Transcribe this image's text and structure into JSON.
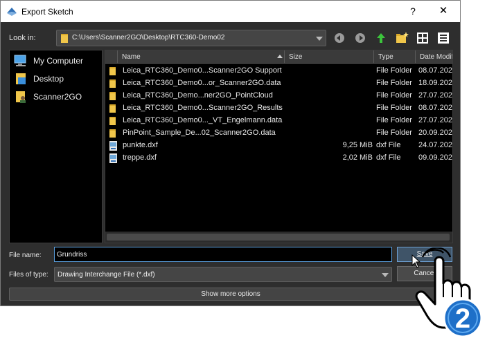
{
  "window": {
    "title": "Export Sketch",
    "help": "?",
    "close": "✕"
  },
  "lookin": {
    "label": "Look in:",
    "path": "C:\\Users\\Scanner2GO\\Desktop\\RTC360-Demo02"
  },
  "toolbar": [
    "back-icon",
    "forward-icon",
    "parent-folder-icon",
    "new-folder-icon",
    "detail-view-icon",
    "list-view-icon"
  ],
  "sidebar": {
    "items": [
      {
        "label": "My Computer",
        "icon": "computer-icon"
      },
      {
        "label": "Desktop",
        "icon": "desktop-icon"
      },
      {
        "label": "Scanner2GO",
        "icon": "user-folder-icon"
      }
    ]
  },
  "columns": {
    "name": "Name",
    "size": "Size",
    "type": "Type",
    "date": "Date Modifi"
  },
  "files": [
    {
      "name": "Leica_RTC360_Demo0...Scanner2GO Support",
      "size": "",
      "type": "File Folder",
      "date": "08.07.202",
      "kind": "folder"
    },
    {
      "name": "Leica_RTC360_Demo0...or_Scanner2GO.data",
      "size": "",
      "type": "File Folder",
      "date": "18.09.202",
      "kind": "folder"
    },
    {
      "name": "Leica_RTC360_Demo...ner2GO_PointCloud",
      "size": "",
      "type": "File Folder",
      "date": "27.07.202",
      "kind": "folder"
    },
    {
      "name": "Leica_RTC360_Demo0...Scanner2GO_Results",
      "size": "",
      "type": "File Folder",
      "date": "08.07.202",
      "kind": "folder"
    },
    {
      "name": "Leica_RTC360_Demo0..._VT_Engelmann.data",
      "size": "",
      "type": "File Folder",
      "date": "27.07.202",
      "kind": "folder"
    },
    {
      "name": "PinPoint_Sample_De...02_Scanner2GO.data",
      "size": "",
      "type": "File Folder",
      "date": "20.09.202",
      "kind": "folder"
    },
    {
      "name": "punkte.dxf",
      "size": "9,25 MiB",
      "type": "dxf File",
      "date": "24.07.202",
      "kind": "file"
    },
    {
      "name": "treppe.dxf",
      "size": "2,02 MiB",
      "type": "dxf File",
      "date": "09.09.202",
      "kind": "file"
    }
  ],
  "filename": {
    "label": "File name:",
    "value": "Grundriss"
  },
  "filetype": {
    "label": "Files of type:",
    "value": "Drawing Interchange File (*.dxf)"
  },
  "buttons": {
    "save": "Save",
    "cancel": "Cancel",
    "more": "Show more options"
  },
  "overlay": {
    "step": "2",
    "icon": "pointing-hand-icon"
  },
  "colors": {
    "accent": "#5aa0e0",
    "folder": "#f0c64a",
    "background": "#2e2e2e",
    "badge": "#1e6fc8"
  }
}
